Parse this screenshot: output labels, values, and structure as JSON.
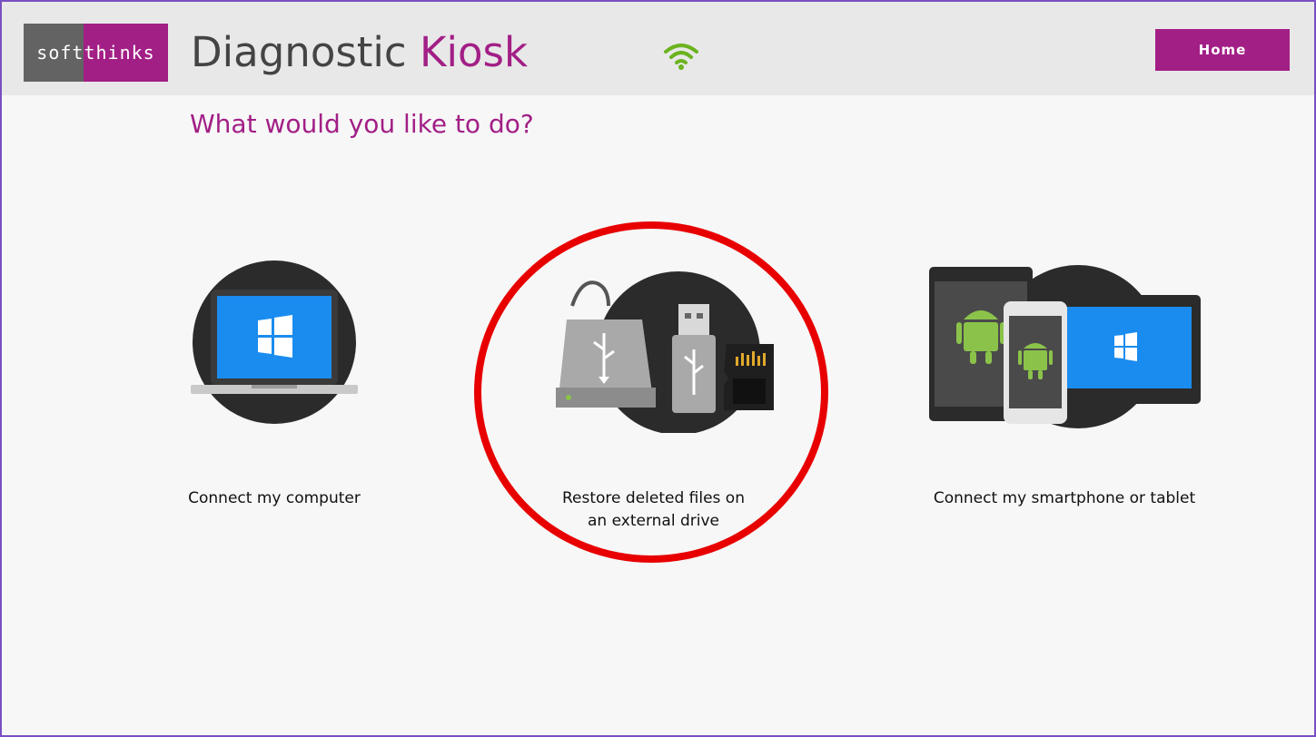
{
  "header": {
    "logo_text": "softthinks",
    "title_main": "Diagnostic",
    "title_accent": "Kiosk",
    "wifi_icon": "wifi-icon",
    "home_label": "Home"
  },
  "main": {
    "question": "What would you like to do?",
    "options": [
      {
        "label": "Connect my computer",
        "icon": "laptop-windows-icon"
      },
      {
        "label": "Restore deleted files on an external drive",
        "icon": "external-drives-icon"
      },
      {
        "label": "Connect my smartphone or tablet",
        "icon": "mobile-devices-icon"
      }
    ]
  },
  "colors": {
    "brand_purple": "#a21f86",
    "logo_gray": "#636363",
    "header_bg": "#e8e8e8",
    "page_bg": "#f7f7f7",
    "wifi_green": "#6bb31f",
    "windows_blue": "#1a8cef",
    "android_green": "#8bc34a",
    "highlight_red": "#e80000",
    "frame_border": "#7a4fc2"
  }
}
